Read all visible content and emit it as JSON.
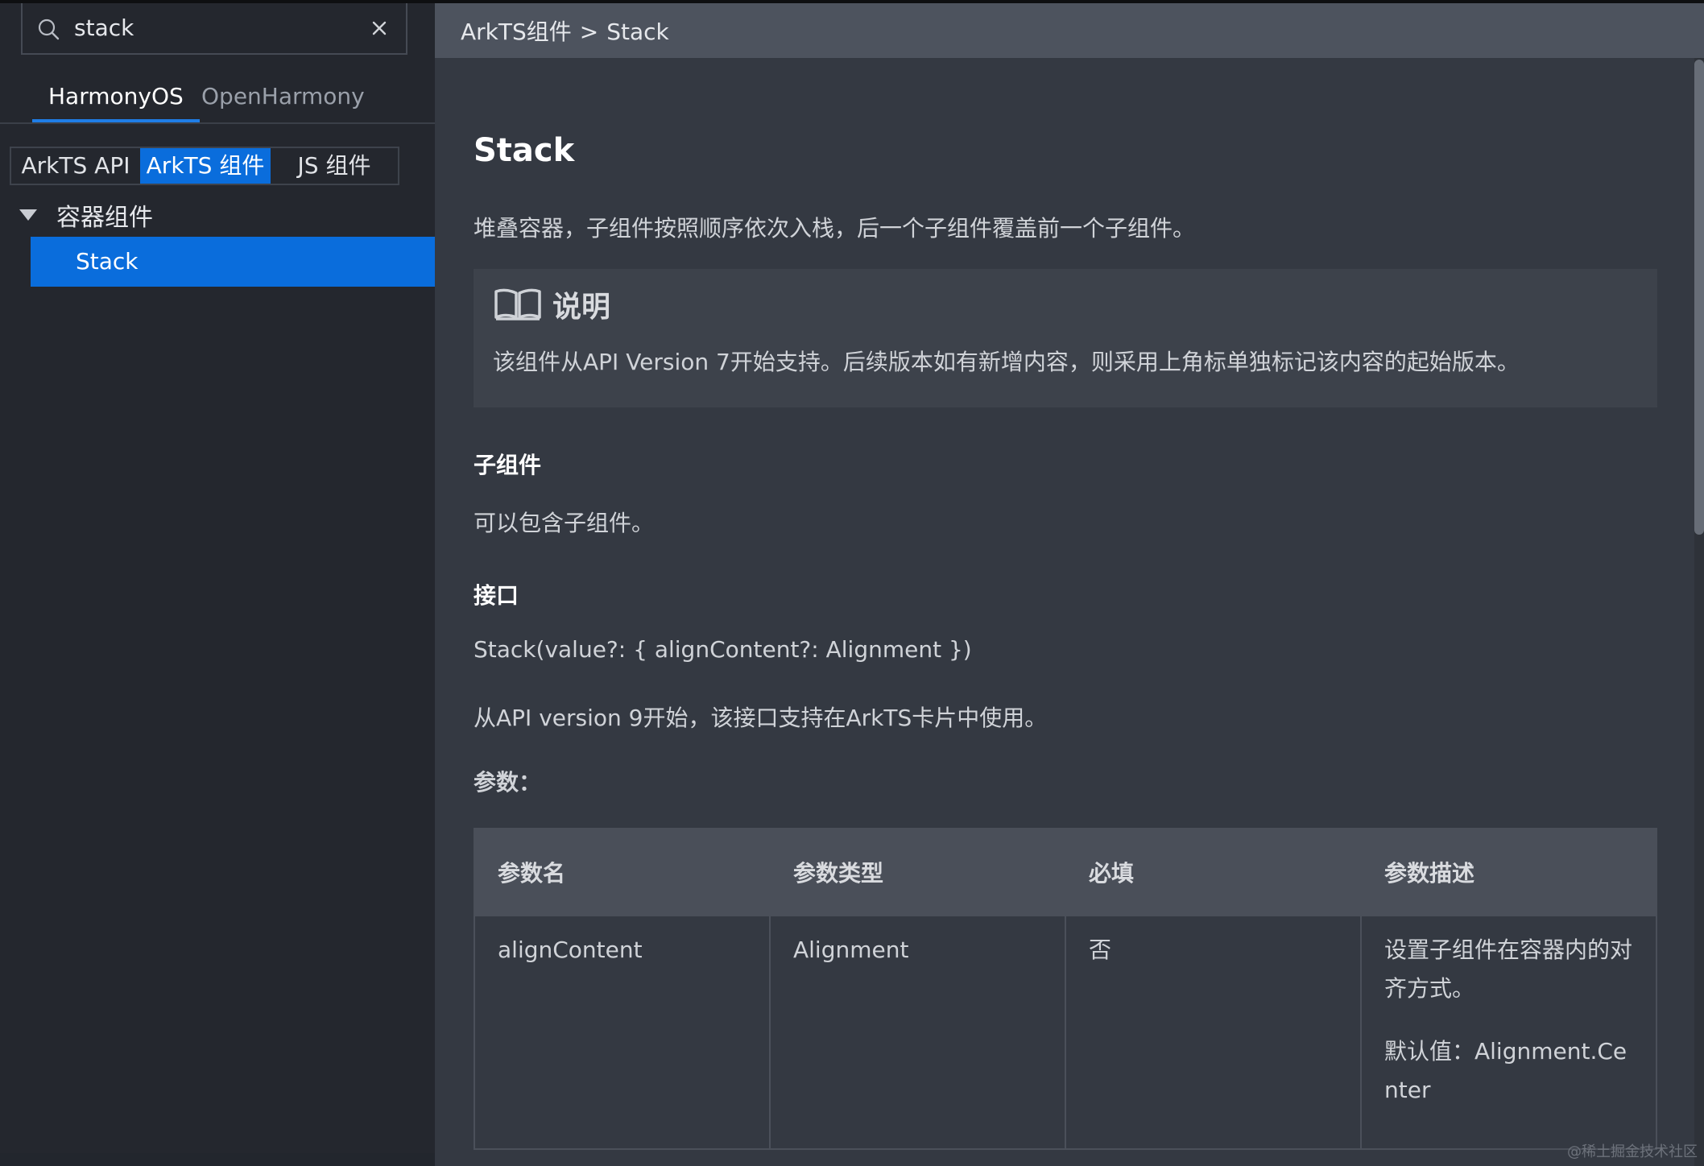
{
  "search": {
    "value": "stack",
    "placeholder": ""
  },
  "os_tabs": [
    {
      "label": "HarmonyOS",
      "active": true
    },
    {
      "label": "OpenHarmony",
      "active": false
    }
  ],
  "category_tabs": [
    {
      "label": "ArkTS API",
      "active": false
    },
    {
      "label": "ArkTS 组件",
      "active": true
    },
    {
      "label": "JS 组件",
      "active": false
    }
  ],
  "tree": {
    "group_label": "容器组件",
    "items": [
      {
        "label": "Stack",
        "selected": true
      }
    ]
  },
  "breadcrumb": {
    "parent": "ArkTS组件",
    "separator": ">",
    "current": "Stack"
  },
  "doc": {
    "title": "Stack",
    "description": "堆叠容器，子组件按照顺序依次入栈，后一个子组件覆盖前一个子组件。",
    "note": {
      "title": "说明",
      "text": "该组件从API Version 7开始支持。后续版本如有新增内容，则采用上角标单独标记该内容的起始版本。"
    },
    "children_heading": "子组件",
    "children_text": "可以包含子组件。",
    "interface_heading": "接口",
    "interface_signature": "Stack(value?: { alignContent?: Alignment })",
    "interface_note": "从API version 9开始，该接口支持在ArkTS卡片中使用。",
    "params_heading": "参数：",
    "params_table": {
      "headers": [
        "参数名",
        "参数类型",
        "必填",
        "参数描述"
      ],
      "rows": [
        {
          "name": "alignContent",
          "type": "Alignment",
          "required": "否",
          "desc": "设置子组件在容器内的对齐方式。",
          "default": "默认值：Alignment.Center"
        }
      ]
    }
  },
  "watermark": "@稀土掘金技术社区",
  "colors": {
    "accent": "#0a6ddc",
    "sidebar_bg": "#24272e",
    "content_bg": "#343942",
    "header_bg": "#4d535e"
  }
}
